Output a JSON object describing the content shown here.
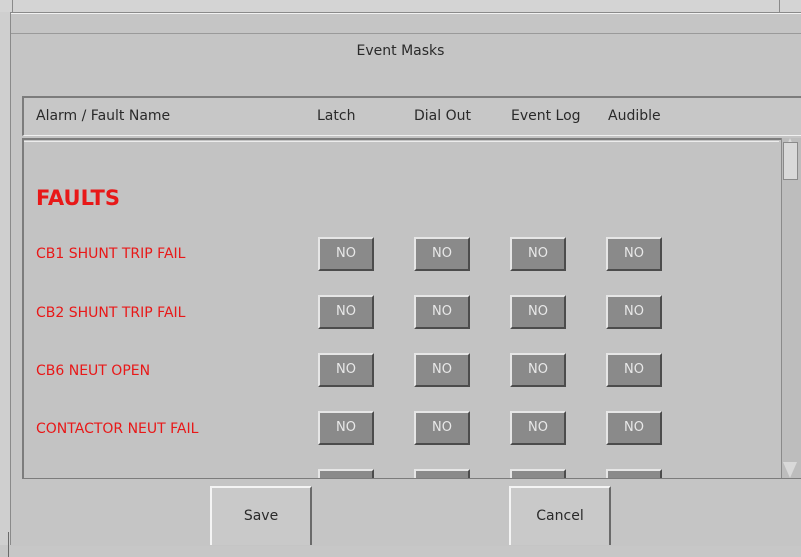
{
  "dialog": {
    "title": "Event Masks"
  },
  "columns": {
    "name": "Alarm / Fault Name",
    "latch": "Latch",
    "dial_out": "Dial Out",
    "event_log": "Event Log",
    "audible": "Audible"
  },
  "section": {
    "title": "FAULTS"
  },
  "rows": [
    {
      "name": "CB1 SHUNT TRIP FAIL",
      "latch": "NO",
      "dial_out": "NO",
      "event_log": "NO",
      "audible": "NO"
    },
    {
      "name": "CB2 SHUNT TRIP FAIL",
      "latch": "NO",
      "dial_out": "NO",
      "event_log": "NO",
      "audible": "NO"
    },
    {
      "name": "CB6 NEUT OPEN",
      "latch": "NO",
      "dial_out": "NO",
      "event_log": "NO",
      "audible": "NO"
    },
    {
      "name": "CONTACTOR NEUT FAIL",
      "latch": "NO",
      "dial_out": "NO",
      "event_log": "NO",
      "audible": "NO"
    }
  ],
  "actions": {
    "save": "Save",
    "cancel": "Cancel"
  },
  "colors": {
    "fault_red": "#e81818",
    "button_gray": "#8a8a8a",
    "background": "#c7c7c7"
  }
}
